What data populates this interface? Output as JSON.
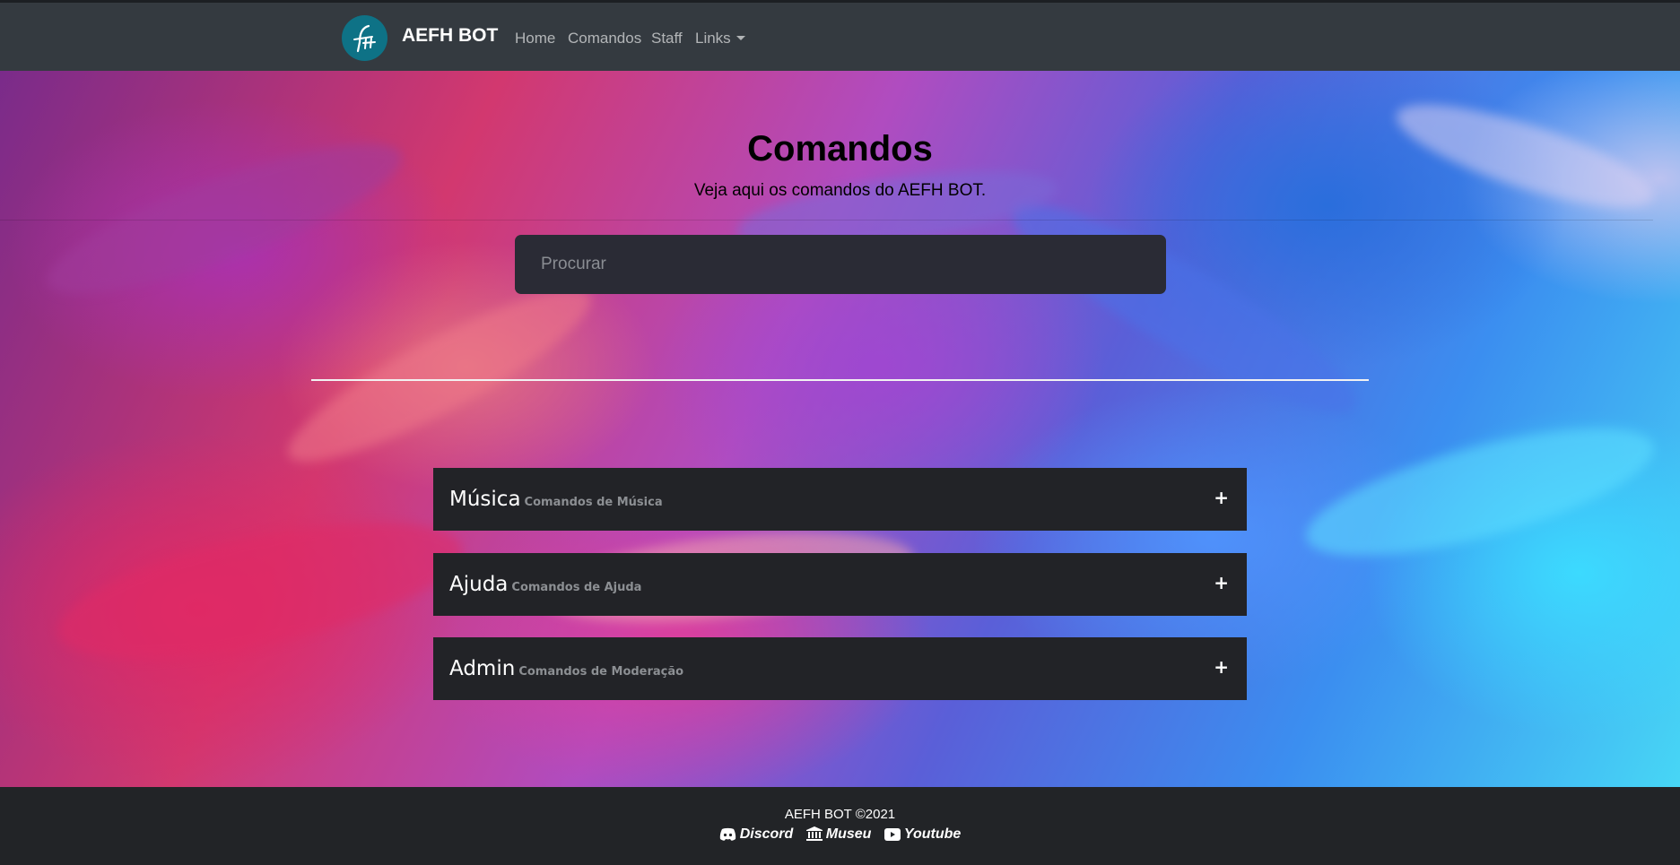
{
  "navbar": {
    "brand": "AEFH BOT",
    "logo_icon": "aefh-logo-icon",
    "links": [
      "Home",
      "Comandos",
      "Staff",
      "Links"
    ],
    "colors": {
      "background": "#343a40",
      "logo_bg": "#0e7286"
    }
  },
  "main": {
    "title": "Comandos",
    "subtitle": "Veja aqui os comandos do AEFH BOT.",
    "search_placeholder": "Procurar"
  },
  "categories": [
    {
      "name": "Música",
      "description": "Comandos de Música",
      "toggle": "+"
    },
    {
      "name": "Ajuda",
      "description": "Comandos de Ajuda",
      "toggle": "+"
    },
    {
      "name": "Admin",
      "description": "Comandos de Moderação",
      "toggle": "+"
    }
  ],
  "footer": {
    "copyright": "AEFH BOT ©2021",
    "links": [
      {
        "label": "Discord",
        "icon": "discord-icon"
      },
      {
        "label": "Museu",
        "icon": "museum-icon"
      },
      {
        "label": "Youtube",
        "icon": "youtube-icon"
      }
    ]
  }
}
